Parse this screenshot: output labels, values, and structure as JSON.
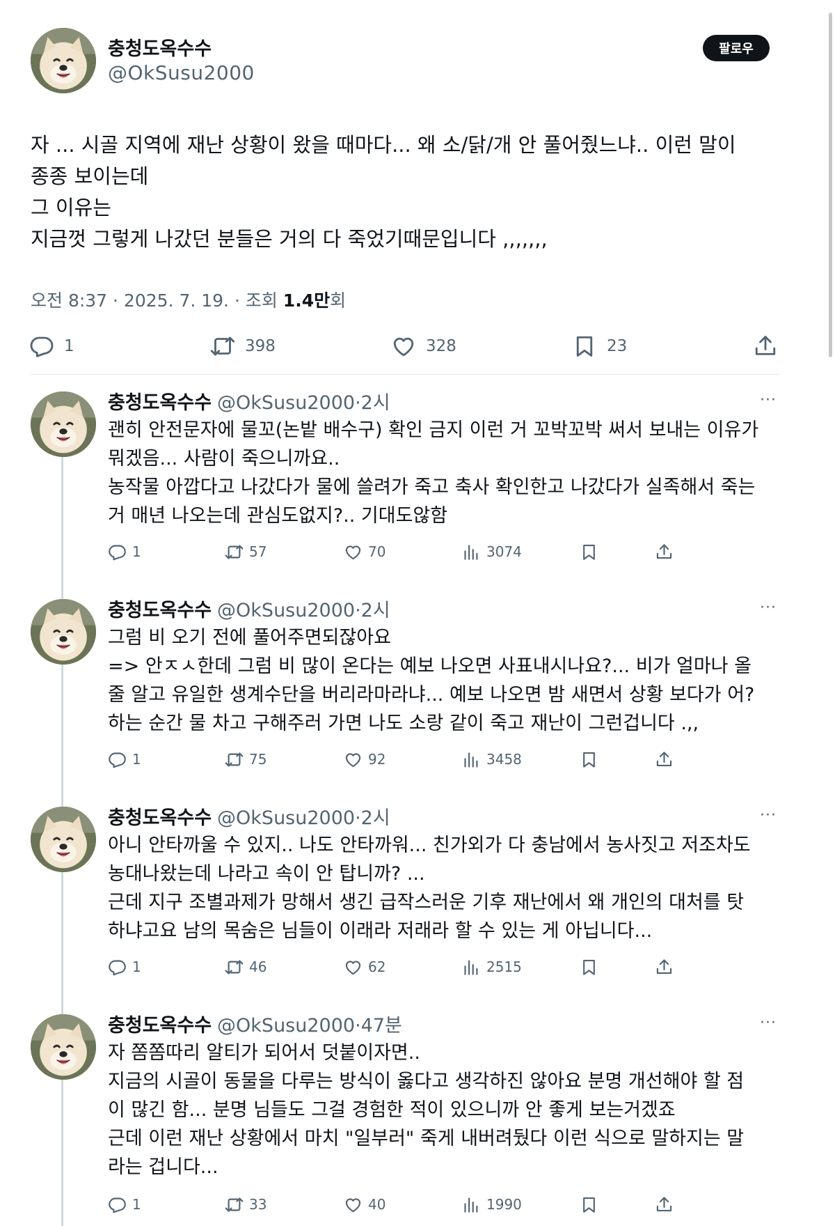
{
  "main_tweet": {
    "name": "충청도옥수수",
    "handle": "@OkSusu2000",
    "follow_label": "팔로우",
    "text": "자 ... 시골 지역에 재난 상황이 왔을 때마다... 왜 소/닭/개 안 풀어줬느냐.. 이런 말이\n종종 보이는데\n그 이유는\n지금껏 그렇게 나갔던 분들은 거의 다 죽었기때문입니다 ,,,,,,,",
    "meta_prefix": "오전 8:37 · 2025. 7. 19. · 조회 ",
    "views": "1.4만",
    "meta_suffix": "회",
    "replies": "1",
    "retweets": "398",
    "likes": "328",
    "bookmarks": "23"
  },
  "replies": [
    {
      "name": "충청도옥수수",
      "handle": "@OkSusu2000",
      "time": "·2시",
      "text": "괜히 안전문자에 물꼬(논밭 배수구) 확인 금지 이런 거 꼬박꼬박 써서 보내는 이유가\n뭐겠음... 사람이 죽으니까요..\n농작물 아깝다고 나갔다가 물에 쓸려가 죽고 축사 확인한고 나갔다가 실족해서 죽는\n거 매년 나오는데 관심도없지?.. 기대도않함",
      "replies": "1",
      "retweets": "57",
      "likes": "70",
      "views": "3074"
    },
    {
      "name": "충청도옥수수",
      "handle": "@OkSusu2000",
      "time": "·2시",
      "text": "그럼 비 오기 전에 풀어주면되잖아요\n=> 안ㅈㅅ한데 그럼 비 많이 온다는 예보 나오면 사표내시나요?... 비가 얼마나 올\n줄 알고 유일한 생계수단을 버리라마라냐... 예보 나오면 밤 새면서 상황 보다가 어?\n하는 순간 물 차고 구해주러 가면 나도 소랑 같이 죽고 재난이 그런겁니다 .,,",
      "replies": "1",
      "retweets": "75",
      "likes": "92",
      "views": "3458"
    },
    {
      "name": "충청도옥수수",
      "handle": "@OkSusu2000",
      "time": "·2시",
      "text": "아니 안타까울 수 있지.. 나도 안타까워... 친가외가 다 충남에서 농사짓고 저조차도\n농대나왔는데 나라고 속이 안 탑니까? ...\n근데 지구 조별과제가 망해서 생긴 급작스러운 기후 재난에서 왜 개인의 대처를 탓\n하냐고요 남의 목숨은 님들이 이래라 저래라 할 수 있는 게 아닙니다...",
      "replies": "1",
      "retweets": "46",
      "likes": "62",
      "views": "2515"
    },
    {
      "name": "충청도옥수수",
      "handle": "@OkSusu2000",
      "time": "·47분",
      "text": "자 쫌쫌따리 알티가 되어서 덧붙이자면..\n지금의 시골이 동물을 다루는 방식이 옳다고 생각하진 않아요 분명 개선해야 할 점\n이 많긴 함... 분명 님들도 그걸 경험한 적이 있으니까 안 좋게 보는거겠죠\n근데 이런 재난 상황에서 마치 \"일부러\" 죽게 내버려뒀다 이런 식으로 말하지는 말\n라는 겁니다...",
      "replies": "1",
      "retweets": "33",
      "likes": "40",
      "views": "1990"
    }
  ],
  "more_glyph": "···",
  "icons": [
    "reply-icon",
    "retweet-icon",
    "like-icon",
    "views-icon",
    "bookmark-icon",
    "share-icon",
    "more-icon"
  ]
}
